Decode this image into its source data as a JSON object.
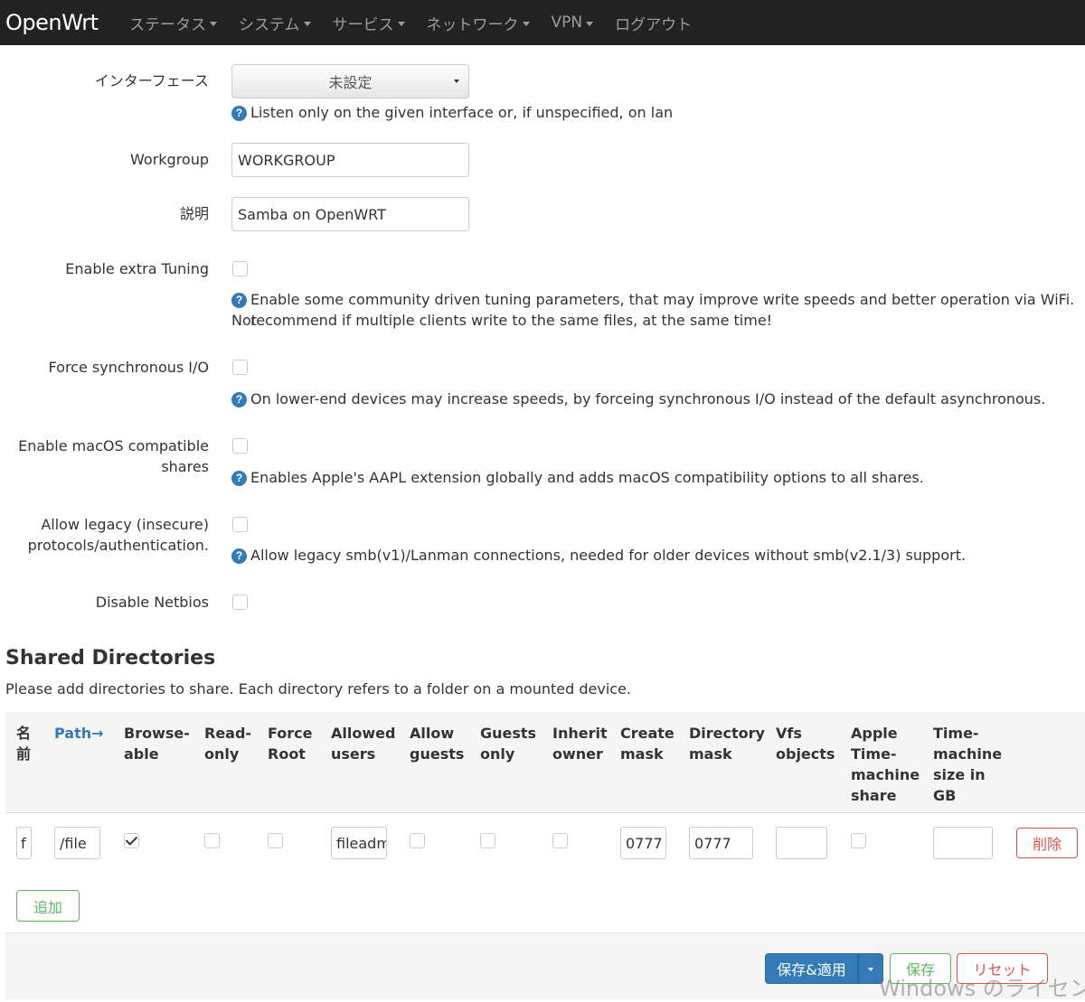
{
  "navbar": {
    "brand": "OpenWrt",
    "items": [
      {
        "label": "ステータス",
        "dropdown": true
      },
      {
        "label": "システム",
        "dropdown": true
      },
      {
        "label": "サービス",
        "dropdown": true
      },
      {
        "label": "ネットワーク",
        "dropdown": true
      },
      {
        "label": "VPN",
        "dropdown": true
      },
      {
        "label": "ログアウト",
        "dropdown": false
      }
    ]
  },
  "form": {
    "interface": {
      "label": "インターフェース",
      "value": "未設定",
      "help": "Listen only on the given interface or, if unspecified, on lan"
    },
    "workgroup": {
      "label": "Workgroup",
      "value": "WORKGROUP"
    },
    "description": {
      "label": "説明",
      "value": "Samba on OpenWRT"
    },
    "extra_tuning": {
      "label": "Enable extra Tuning",
      "checked": false,
      "help_line1": "Enable some community driven tuning parameters, that may improve write speeds and better operation via WiFi. Not",
      "help_line2": "recommend if multiple clients write to the same files, at the same time!"
    },
    "force_sync_io": {
      "label": "Force synchronous I/O",
      "checked": false,
      "help": "On lower-end devices may increase speeds, by forceing synchronous I/O instead of the default asynchronous."
    },
    "macos": {
      "label_line1": "Enable macOS compatible",
      "label_line2": "shares",
      "checked": false,
      "help": "Enables Apple's AAPL extension globally and adds macOS compatibility options to all shares."
    },
    "legacy": {
      "label_line1": "Allow legacy (insecure)",
      "label_line2": "protocols/authentication.",
      "checked": false,
      "help": "Allow legacy smb(v1)/Lanman connections, needed for older devices without smb(v2.1/3) support."
    },
    "netbios": {
      "label": "Disable Netbios",
      "checked": false
    }
  },
  "shares": {
    "title": "Shared Directories",
    "description": "Please add directories to share. Each directory refers to a folder on a mounted device.",
    "headers": {
      "name": [
        "名",
        "前"
      ],
      "path": "Path→",
      "browseable": [
        "Browse-",
        "able"
      ],
      "read_only": [
        "Read-",
        "only"
      ],
      "force_root": [
        "Force",
        "Root"
      ],
      "allowed_users": [
        "Allowed",
        "users"
      ],
      "allow_guests": [
        "Allow",
        "guests"
      ],
      "guests_only": [
        "Guests",
        "only"
      ],
      "inherit_owner": [
        "Inherit",
        "owner"
      ],
      "create_mask": [
        "Create",
        "mask"
      ],
      "directory_mask": [
        "Directory",
        "mask"
      ],
      "vfs_objects": [
        "Vfs",
        "objects"
      ],
      "apple_tm": [
        "Apple",
        "Time-",
        "machine",
        "share"
      ],
      "tm_size": [
        "Time-",
        "machine",
        "size in",
        "GB"
      ]
    },
    "row": {
      "name": "f",
      "path": "/file",
      "browseable": true,
      "read_only": false,
      "force_root": false,
      "allowed_users": "fileadm",
      "allow_guests": false,
      "guests_only": false,
      "inherit_owner": false,
      "create_mask": "0777",
      "directory_mask": "0777",
      "vfs_objects": "",
      "apple_tm": false,
      "tm_size": "",
      "delete_label": "削除"
    },
    "add_label": "追加"
  },
  "footer": {
    "apply_label": "保存&適用",
    "save_label": "保存",
    "reset_label": "リセット"
  },
  "watermark": "Windows のライセンス言",
  "colors": {
    "navbar_bg": "#222222",
    "primary": "#337ab7",
    "success": "#5cb85c",
    "danger": "#d9534f"
  }
}
